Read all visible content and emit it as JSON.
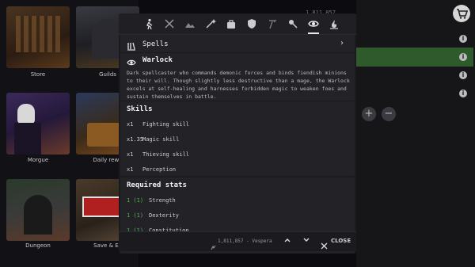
{
  "locations": [
    {
      "label": "Store"
    },
    {
      "label": "Guilds"
    },
    {
      "label": "Morgue"
    },
    {
      "label": "Daily rewa"
    },
    {
      "label": "Dungeon"
    },
    {
      "label": "Save & Ex"
    }
  ],
  "header": {
    "gold_top": "1,811,857"
  },
  "toolbar": {
    "icons": [
      "walking-icon",
      "swords-icon",
      "hills-icon",
      "wand-icon",
      "bag-icon",
      "shield-icon",
      "hoe-icon",
      "flail-icon",
      "eye-icon",
      "campfire-icon"
    ],
    "active": "eye-icon"
  },
  "spells": {
    "label": "Spells"
  },
  "class_info": {
    "name": "Warlock",
    "description": "Dark spellcaster who commands demonic forces and binds fiendish minions to their will. Though slightly less destructive than a mage, the Warlock excels at self-healing and harnesses forbidden magic to weaken foes and sustain themselves in battle."
  },
  "skills": {
    "title": "Skills",
    "items": [
      {
        "mult": "x1",
        "name": "Fighting skill"
      },
      {
        "mult": "x1.35",
        "name": "Magic skill"
      },
      {
        "mult": "x1",
        "name": "Thieving skill"
      },
      {
        "mult": "x1",
        "name": "Perception"
      }
    ]
  },
  "required_stats": {
    "title": "Required stats",
    "items": [
      {
        "val": "1 (1)",
        "name": "Strength"
      },
      {
        "val": "1 (1)",
        "name": "Dexterity"
      },
      {
        "val": "1 (1)",
        "name": "Constitution"
      }
    ]
  },
  "footer": {
    "gold": "1,811,857 - Vespera",
    "close_label": "CLOSE"
  },
  "colors": {
    "accent_green": "#2f5a2c",
    "stat_green": "#4fb34f"
  }
}
